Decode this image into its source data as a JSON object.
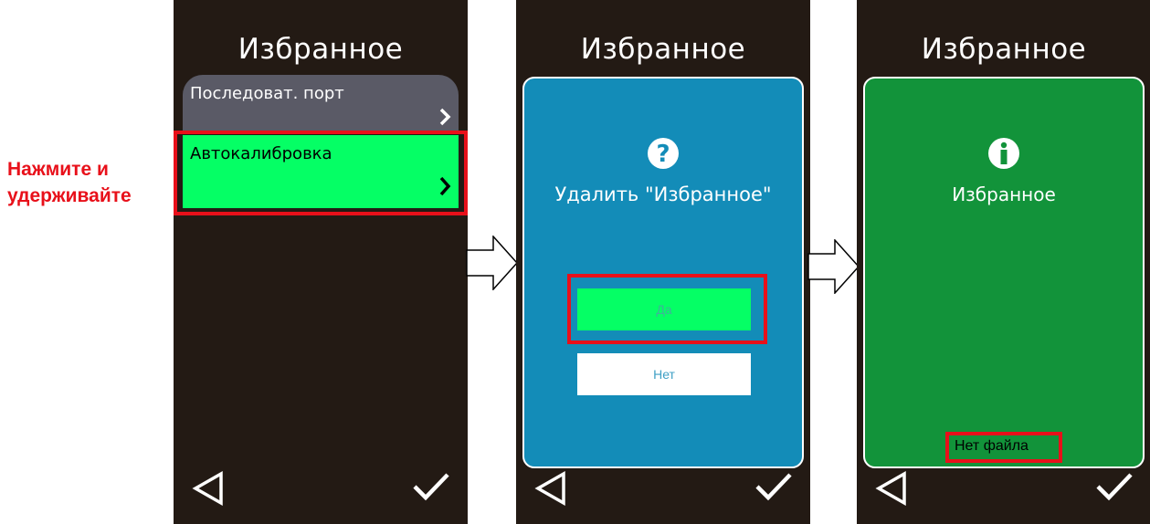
{
  "annotation": {
    "line1": "Нажмите и",
    "line2": "удерживайте"
  },
  "screens": [
    {
      "title": "Избранное",
      "items": [
        {
          "label": "Последоват. порт",
          "chevron": "›"
        },
        {
          "label": "Автокалибровка",
          "chevron": "›"
        }
      ]
    },
    {
      "title": "Избранное",
      "dialog": {
        "icon": "question-icon",
        "message": "Удалить \"Избранное\"",
        "buttons": {
          "yes": "Да",
          "no": "Нет"
        }
      }
    },
    {
      "title": "Избранное",
      "dialog": {
        "icon": "info-icon",
        "message": "Избранное",
        "status": "Нет файла"
      }
    }
  ],
  "nav": {
    "back_icon": "back-triangle-icon",
    "ok_icon": "check-icon"
  },
  "colors": {
    "screen_bg": "#231a14",
    "highlight": "#e8101a",
    "item_selected": "#05ff65",
    "item_default": "#5a5a66",
    "dialog_blue": "#138cb8",
    "dialog_green": "#12933a"
  }
}
